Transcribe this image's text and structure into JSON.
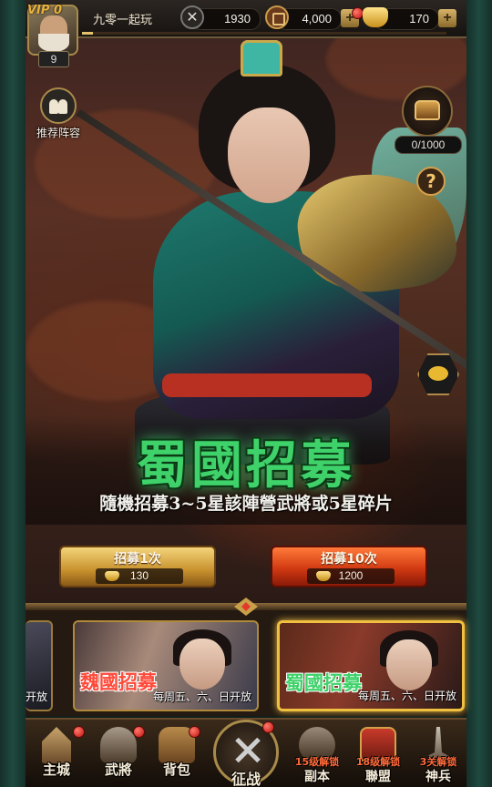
{
  "player": {
    "vip_label": "VIP 0",
    "level": "9",
    "name": "九零一起玩",
    "exp_fraction": 0.03
  },
  "resources": {
    "military": "1930",
    "copper": "4,000",
    "gold": "170"
  },
  "side": {
    "recommend_label": "推荐阵容",
    "chest_count": "0/1000",
    "help_symbol": "?"
  },
  "recruit": {
    "title": "蜀國招募",
    "subtitle": "隨機招募3~5星該陣營武將或5星碎片",
    "single": {
      "label": "招募1次",
      "cost": "130"
    },
    "ten": {
      "label": "招募10次",
      "cost": "1200"
    }
  },
  "cards": {
    "left_partial_text": "开放",
    "wei": {
      "faction": "魏國招募",
      "schedule": "每周五、六、日开放"
    },
    "shu": {
      "faction": "蜀國招募",
      "schedule": "每周五、六、日开放"
    }
  },
  "nav": {
    "items": [
      {
        "label": "主城",
        "icon": "city-icon"
      },
      {
        "label": "武將",
        "icon": "general-icon"
      },
      {
        "label": "背包",
        "icon": "bag-icon"
      },
      {
        "label": "征战",
        "icon": "crossed-swords-icon"
      },
      {
        "label": "副本",
        "lock": "15级解锁",
        "icon": "dungeon-icon"
      },
      {
        "label": "聯盟",
        "lock": "18级解锁",
        "icon": "alliance-icon"
      },
      {
        "label": "神兵",
        "lock": "3关解锁",
        "icon": "divine-weapon-icon"
      }
    ]
  },
  "colors": {
    "shu_green": "#3fd26a",
    "wei_red": "#ff4a3a",
    "gold_accent": "#d4a04a"
  }
}
